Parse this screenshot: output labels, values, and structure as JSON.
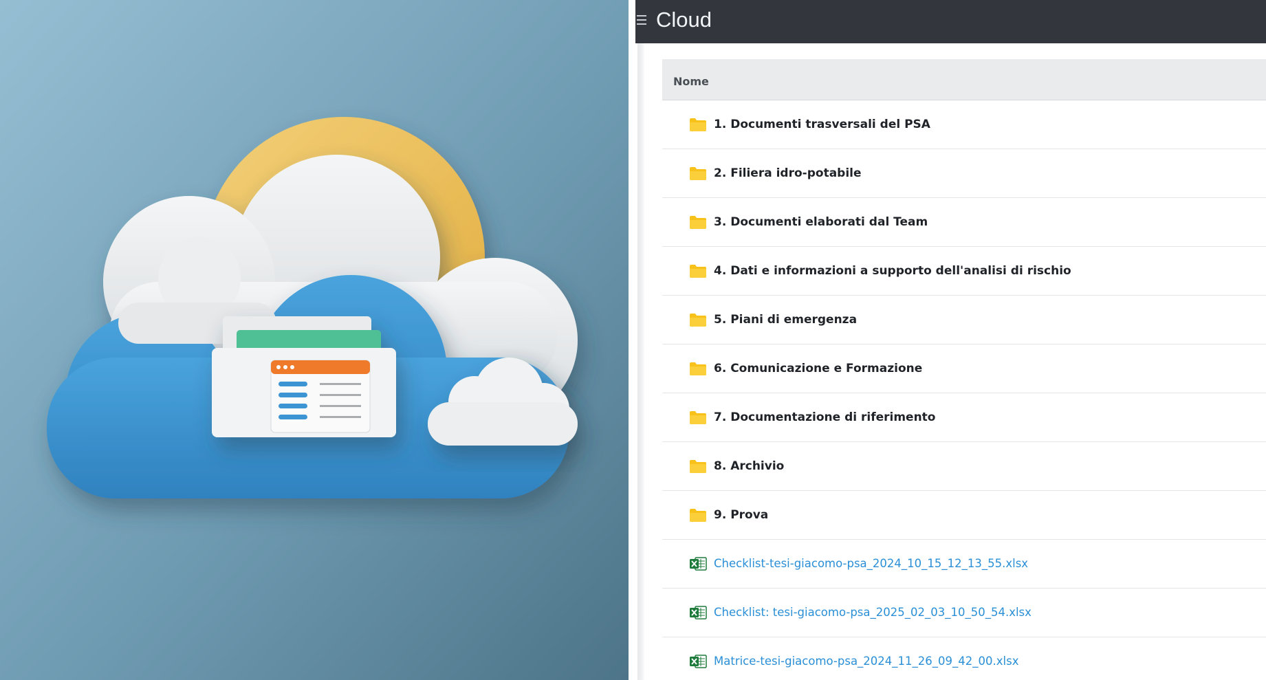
{
  "header": {
    "menu_icon": "hamburger-menu-icon",
    "title": "Cloud"
  },
  "table": {
    "column_name": "Nome",
    "folders": [
      {
        "label": "1. Documenti trasversali del PSA",
        "icon": "folder-icon"
      },
      {
        "label": "2. Filiera idro-potabile",
        "icon": "folder-icon"
      },
      {
        "label": "3. Documenti elaborati dal Team",
        "icon": "folder-icon"
      },
      {
        "label": "4. Dati e informazioni a supporto dell'analisi di rischio",
        "icon": "folder-icon"
      },
      {
        "label": "5. Piani di emergenza",
        "icon": "folder-icon"
      },
      {
        "label": "6. Comunicazione e Formazione",
        "icon": "folder-icon"
      },
      {
        "label": "7. Documentazione di riferimento",
        "icon": "folder-icon"
      },
      {
        "label": "8. Archivio",
        "icon": "folder-icon"
      },
      {
        "label": "9. Prova",
        "icon": "folder-icon"
      }
    ],
    "files": [
      {
        "label": "Checklist-tesi-giacomo-psa_2024_10_15_12_13_55.xlsx",
        "icon": "excel-icon"
      },
      {
        "label": "Checklist: tesi-giacomo-psa_2025_02_03_10_50_54.xlsx",
        "icon": "excel-icon"
      },
      {
        "label": "Matrice-tesi-giacomo-psa_2024_11_26_09_42_00.xlsx",
        "icon": "excel-icon"
      }
    ]
  },
  "colors": {
    "topbar": "#33373d",
    "folder": "#f8c21a",
    "link": "#2a8fd6",
    "excel": "#1e7b3c",
    "illustration_bg": "#6f9bb2",
    "cloud_blue": "#3f93cf",
    "sun": "#efc463"
  }
}
